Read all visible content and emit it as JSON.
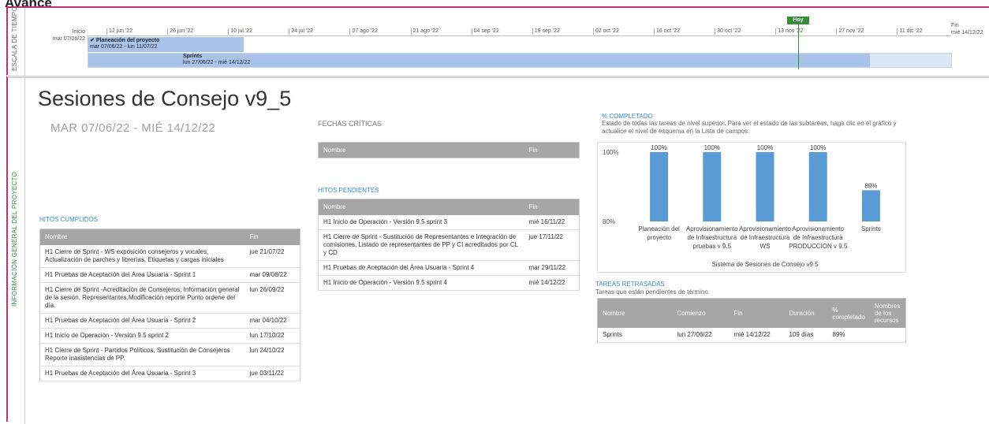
{
  "page_heading": "Avance",
  "timeline": {
    "side_label": "ESCALA DE TIEMPO",
    "start_label": "Inicio",
    "start_date": "mar 07/06/22",
    "end_label": "Fin",
    "end_date": "mié 14/12/22",
    "ticks": [
      "12 jun '22",
      "26 jun '22",
      "10 jul '22",
      "24 jul '22",
      "07 ago '22",
      "21 ago '22",
      "04 sep '22",
      "18 sep '22",
      "02 oct '22",
      "16 oct '22",
      "30 oct '22",
      "13 nov '22",
      "27 nov '22",
      "11 dic '22"
    ],
    "today_label": "Hoy",
    "tasks": [
      {
        "name": "Planeación del proyecto",
        "dates": "mar 07/06/22 - lun 11/07/22",
        "check": "✔"
      },
      {
        "name": "Sprints",
        "dates": "lun 27/06/22 - mié 14/12/22"
      }
    ]
  },
  "main": {
    "side_label": "INFORMACIÓN GENERAL DEL PROYECTO",
    "project_title": "Sesiones de Consejo v9_5",
    "project_dates": "MAR 07/06/22 - MIÉ 14/12/22"
  },
  "fechas_criticas": {
    "label": "FECHAS CRÍTICAS",
    "headers": [
      "Nombre",
      "Fin"
    ]
  },
  "hitos_pendientes": {
    "label": "HITOS PENDIENTES",
    "headers": [
      "Nombre",
      "Fin"
    ],
    "rows": [
      [
        "H1 Inicio de Operación - Versión 9.5 sprint 3",
        "mié 16/11/22"
      ],
      [
        "H1 Cierre de Sprint - Sustitución de Representantes e Integración de comisiones, Listado de representantes de PP y CI acreditados por CL y CD",
        "jue 17/11/22"
      ],
      [
        "H1 Pruebas de Aceptación del Área Usuaria - Sprint 4",
        "mar 29/11/22"
      ],
      [
        "H1 Inicio de Operación - Versión 9.5 sprint 4",
        "mié 14/12/22"
      ]
    ]
  },
  "hitos_cumplidos": {
    "label": "HITOS CUMPLIDOS",
    "headers": [
      "Nombre",
      "Fin"
    ],
    "rows": [
      [
        "H1 Cierre de Sprint - WS exposición consejeros y vocales, Actualización de parches y librerías, Etiquetas y cargas iniciales",
        "jue 21/07/22"
      ],
      [
        "H1 Pruebas de Aceptación del Área Usuaria - Sprint 1",
        "mar 09/08/22"
      ],
      [
        "H1 Cierre de Sprint -Acreditación de Consejeros, Información general de la sesión, Representantes,Modificación reporte Punto ordene del día.",
        "lun 26/09/22"
      ],
      [
        "H1 Pruebas de Aceptación del Área Usuaria - Sprint 2",
        "mar 04/10/22"
      ],
      [
        "H1 Inicio de Operación - Versión 9.5 sprint 2",
        "lun 17/10/22"
      ],
      [
        "H1 Cierre de Sprint - Partidos Políticos, Sustitución de Consejeros Reporte inasistencias de PP.",
        "lun 24/10/22"
      ],
      [
        "H1 Pruebas de Aceptación del Área Usuaria - Sprint 3",
        "jue 03/11/22"
      ]
    ]
  },
  "completado": {
    "label": "% COMPLETADO",
    "description": "Estado de todas las tareas de nivel superior. Para ver el estado de las subtareas, haga clic en el gráfico y actualice el nivel de esquema en la Lista de campos."
  },
  "chart_data": {
    "type": "bar",
    "categories": [
      [
        "Planeación del",
        "proyecto"
      ],
      [
        "Aprovisionamiento",
        "de Infraestructura",
        "pruebas v 9.5"
      ],
      [
        "Aprovisionamiento",
        "de Infraestructura",
        "WS"
      ],
      [
        "Aprovisionamiento",
        "de Infraestructura",
        "PRODUCCION v 9.5"
      ],
      [
        "Sprints"
      ]
    ],
    "values": [
      100,
      100,
      100,
      100,
      89
    ],
    "value_labels": [
      "100%",
      "100%",
      "100%",
      "100%",
      "89%"
    ],
    "ylim": [
      80,
      100
    ],
    "y_ticks": [
      "100%",
      "80%"
    ],
    "xlabel": "Sistema de Sesiones de Consejo v9.5",
    "bar_color": "#5b9bd5"
  },
  "tareas_retrasadas": {
    "label": "TAREAS RETRASADAS",
    "subtitle": "Tareas que están pendientes de término.",
    "headers": [
      "Nombre",
      "Comienzo",
      "Fin",
      "Duración",
      "% completado",
      "Nombres de los recursos"
    ],
    "rows": [
      [
        "Sprints",
        "lun 27/06/22",
        "mié 14/12/22",
        "109 días",
        "89%",
        ""
      ]
    ]
  },
  "colors": {
    "accent_frame": "#c0306a",
    "section_blue": "#3b8ad0",
    "today_green": "#3a8a3a",
    "table_header": "#a6a6a6"
  }
}
